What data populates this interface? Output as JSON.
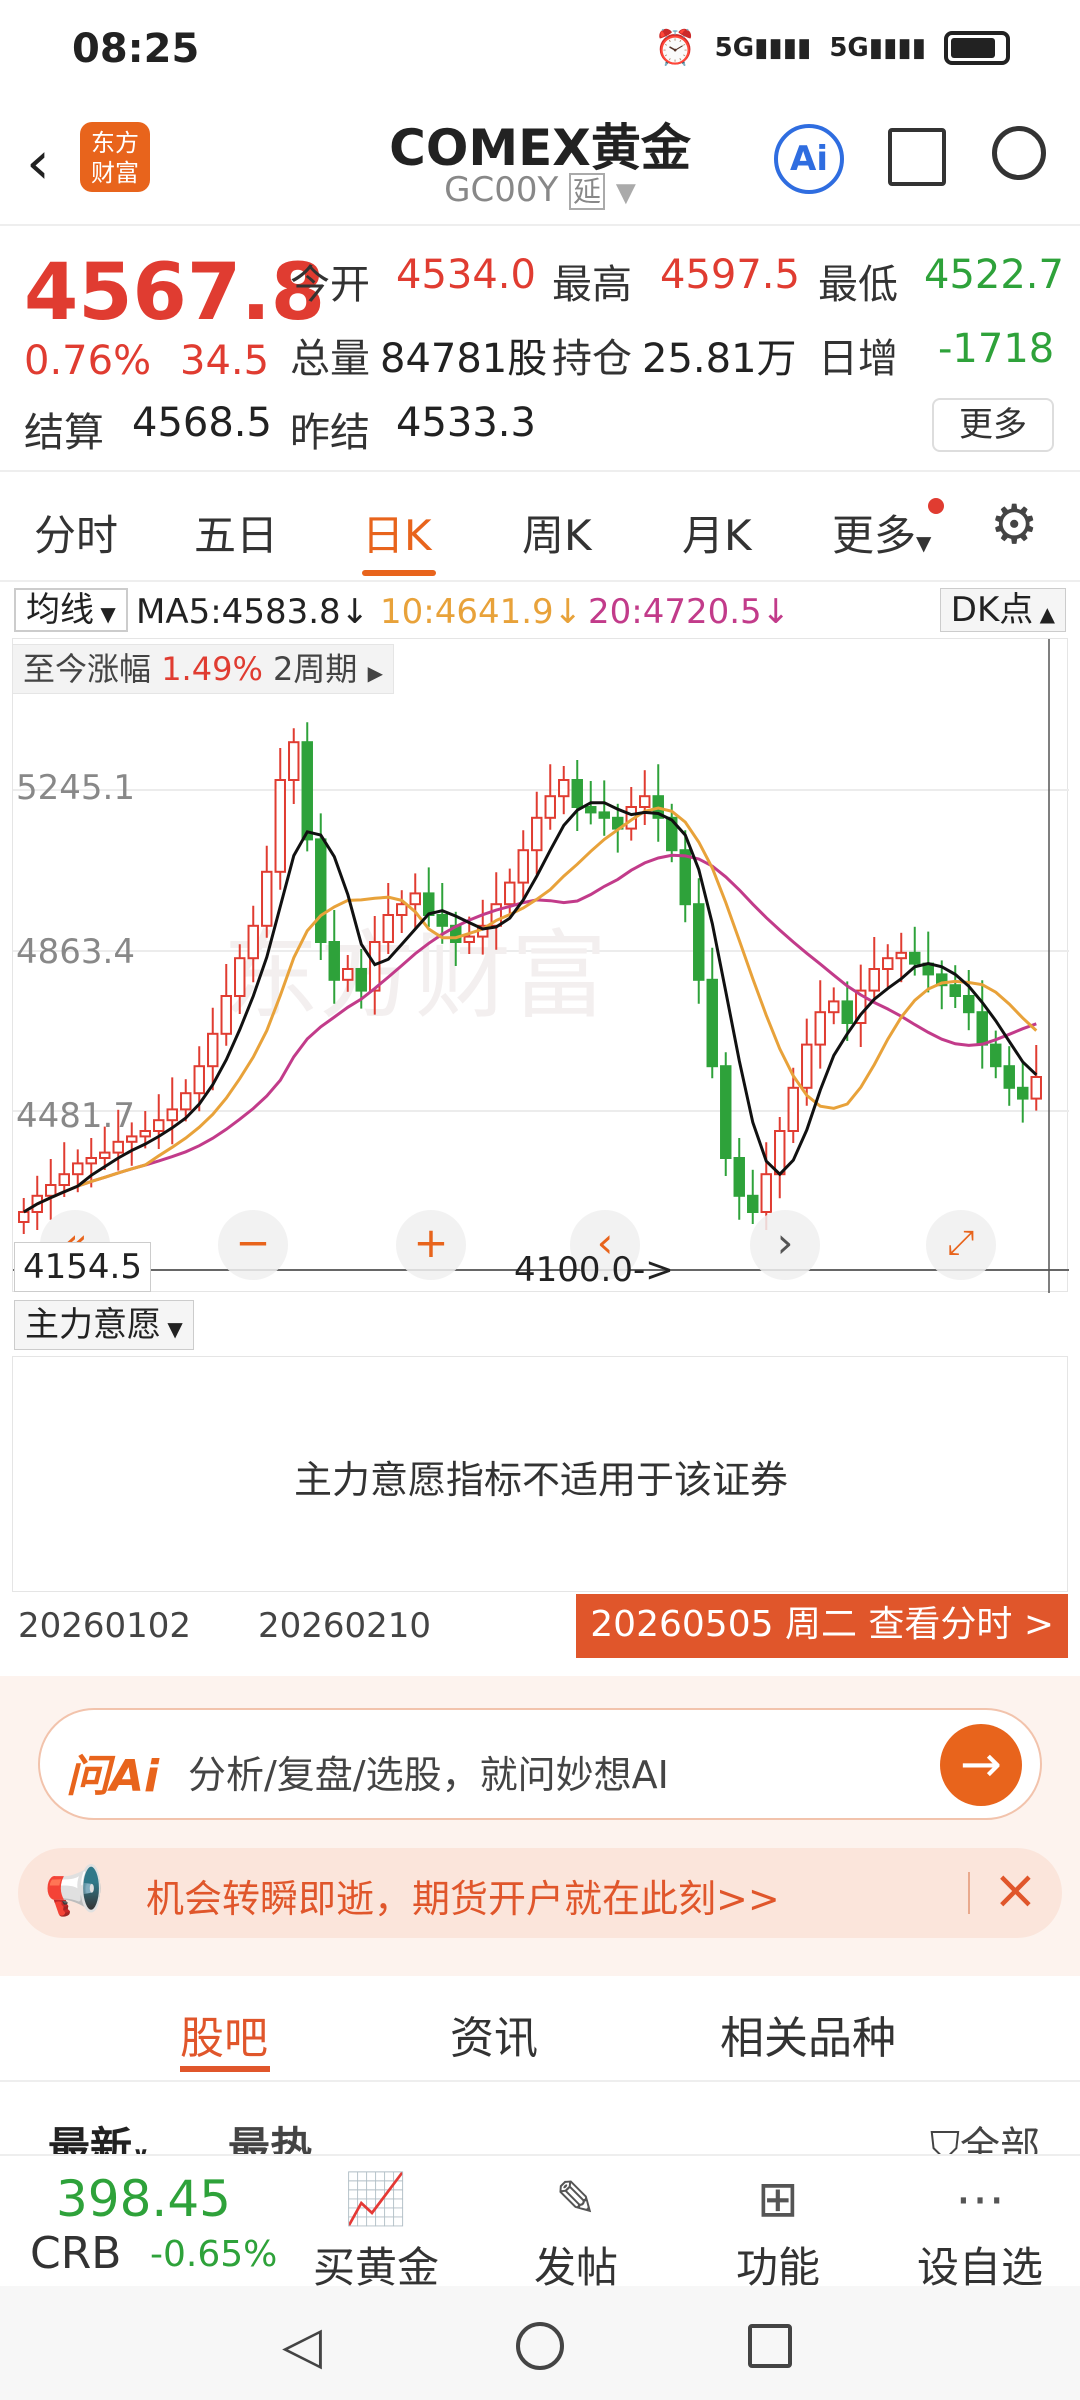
{
  "status_bar": {
    "time": "08:25",
    "net1": "5G",
    "net2": "5G"
  },
  "header": {
    "title": "COMEX黄金",
    "code": "GC00Y",
    "delayed_badge": "延",
    "logo_text": "东方\n财富",
    "ai_icon": "Ai"
  },
  "quote": {
    "price": "4567.8",
    "change_pct": "0.76%",
    "change": "34.5",
    "open_label": "今开",
    "open": "4534.0",
    "high_label": "最高",
    "high": "4597.5",
    "low_label": "最低",
    "low": "4522.7",
    "volume_label": "总量",
    "volume": "84781股",
    "oi_label": "持仓",
    "oi": "25.81万",
    "daily_inc_label": "日增",
    "daily_inc": "-1718",
    "settle_label": "结算",
    "settle": "4568.5",
    "prev_settle_label": "昨结",
    "prev_settle": "4533.3",
    "more_button": "更多"
  },
  "tabs": [
    {
      "label": "分时"
    },
    {
      "label": "五日"
    },
    {
      "label": "日K"
    },
    {
      "label": "周K"
    },
    {
      "label": "月K"
    },
    {
      "label": "更多"
    }
  ],
  "ma": {
    "selector": "均线",
    "ma5": "MA5:4583.8↓",
    "ma10": "10:4641.9↓",
    "ma20": "20:4720.5↓",
    "dk": "DK点"
  },
  "chart": {
    "range_label": "至今涨幅",
    "range_value": "1.49%",
    "range_period": "2周期",
    "y_ticks": [
      "5245.1",
      "4863.4",
      "4481.7"
    ],
    "low_price": "4154.5",
    "low_mark": "4100.0->",
    "watermark": "东方财富",
    "colors": {
      "up": "#e03c31",
      "down": "#2ea23a",
      "ma5": "#111111",
      "ma10": "#e8a23a",
      "ma20": "#c23b8a"
    }
  },
  "indicator": {
    "selector": "主力意愿",
    "message": "主力意愿指标不适用于该证券"
  },
  "dates": {
    "start": "20260102",
    "mid": "20260210",
    "current_button": "20260505 周二 查看分时 >"
  },
  "ai_search": {
    "logo": "问Ai",
    "text": "分析/复盘/选股，就问妙想AI"
  },
  "promo": {
    "text": "机会转瞬即逝，期货开户就在此刻>>"
  },
  "sub_tabs": [
    {
      "label": "股吧"
    },
    {
      "label": "资讯"
    },
    {
      "label": "相关品种"
    }
  ],
  "sort": {
    "latest": "最新",
    "hot": "最热",
    "filter": "全部"
  },
  "bottom": {
    "crb_value": "398.45",
    "crb_name": "CRB",
    "crb_change": "-0.65%",
    "items": [
      {
        "label": "买黄金"
      },
      {
        "label": "发帖"
      },
      {
        "label": "功能"
      },
      {
        "label": "设自选"
      }
    ]
  }
}
